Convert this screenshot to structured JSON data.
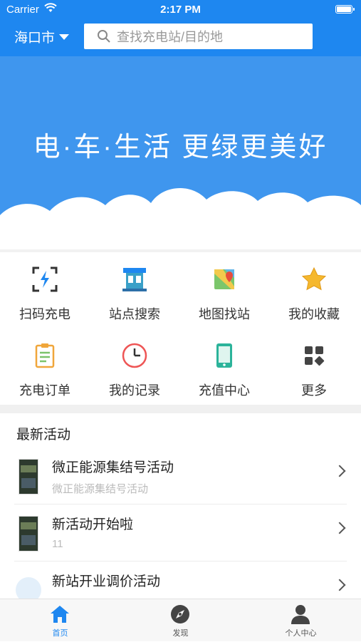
{
  "status_bar": {
    "carrier": "Carrier",
    "time": "2:17 PM"
  },
  "header": {
    "city": "海口市",
    "search_placeholder": "查找充电站/目的地"
  },
  "banner": {
    "slogan": "电·车·生活 更绿更美好"
  },
  "quick_actions": [
    {
      "label": "扫码充电",
      "icon": "scan-charge-icon"
    },
    {
      "label": "站点搜索",
      "icon": "station-search-icon"
    },
    {
      "label": "地图找站",
      "icon": "map-icon"
    },
    {
      "label": "我的收藏",
      "icon": "star-icon"
    },
    {
      "label": "充电订单",
      "icon": "clipboard-icon"
    },
    {
      "label": "我的记录",
      "icon": "clock-icon"
    },
    {
      "label": "充值中心",
      "icon": "phone-icon"
    },
    {
      "label": "更多",
      "icon": "more-grid-icon"
    }
  ],
  "activities": {
    "section_title": "最新活动",
    "items": [
      {
        "title": "微正能源集结号活动",
        "subtitle": "微正能源集结号活动"
      },
      {
        "title": "新活动开始啦",
        "subtitle": "11"
      },
      {
        "title": "新站开业调价活动",
        "subtitle": ""
      }
    ]
  },
  "tabbar": [
    {
      "label": "首页",
      "icon": "home-icon",
      "active": true
    },
    {
      "label": "发现",
      "icon": "discover-icon",
      "active": false
    },
    {
      "label": "个人中心",
      "icon": "user-icon",
      "active": false
    }
  ],
  "colors": {
    "primary": "#1e87f0",
    "banner": "#3f96ee"
  }
}
